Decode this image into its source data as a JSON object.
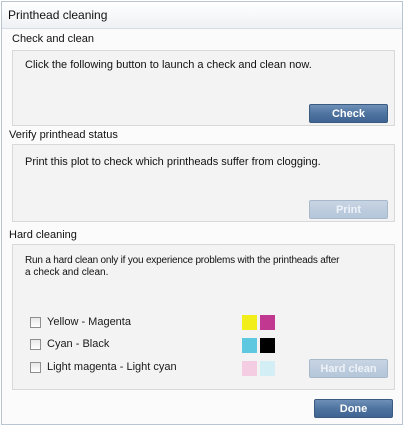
{
  "window": {
    "title": "Printhead cleaning"
  },
  "check_and_clean": {
    "title": "Check and clean",
    "description": "Click the following button to launch a check and clean now.",
    "button": "Check"
  },
  "verify": {
    "title": "Verify printhead status",
    "description": "Print this plot to check which printheads suffer from clogging.",
    "button": "Print"
  },
  "hard_cleaning": {
    "title": "Hard cleaning",
    "description_line1": "Run a hard clean only if you experience problems with the printheads after",
    "description_line2": "a check and clean.",
    "options": [
      {
        "label": "Yellow - Magenta",
        "checked": false,
        "colors": [
          "#f2ee1b",
          "#c0388f"
        ]
      },
      {
        "label": "Cyan - Black",
        "checked": false,
        "colors": [
          "#5ec8e0",
          "#000000"
        ]
      },
      {
        "label": "Light magenta - Light cyan",
        "checked": false,
        "colors": [
          "#f5cde3",
          "#d4eef6"
        ]
      }
    ],
    "button": "Hard clean"
  },
  "footer": {
    "done_button": "Done"
  }
}
